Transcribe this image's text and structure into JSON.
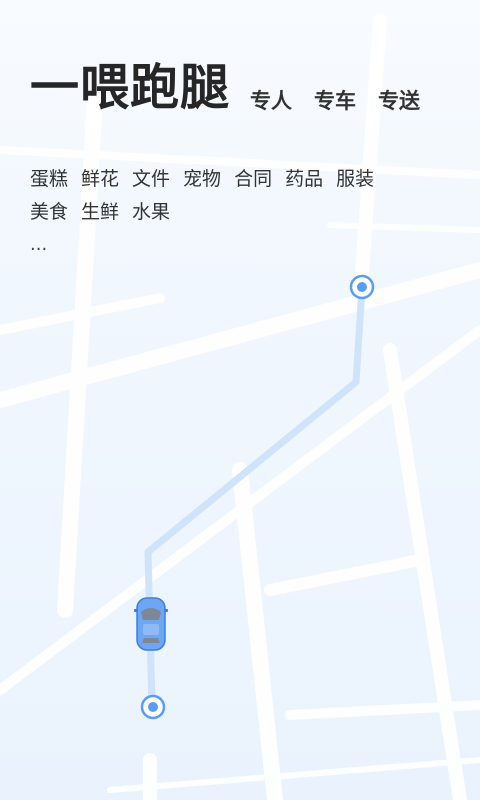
{
  "app": {
    "title": "一喂跑腿"
  },
  "services": [
    "专人",
    "专车",
    "专送"
  ],
  "categories": [
    "蛋糕",
    "鲜花",
    "文件",
    "宠物",
    "合同",
    "药品",
    "服装",
    "美食",
    "生鲜",
    "水果"
  ],
  "more_indicator": "...",
  "map": {
    "route_color": "#cfe3fb",
    "marker_color": "#5a9cf0",
    "car_color": "#6da6f2"
  }
}
